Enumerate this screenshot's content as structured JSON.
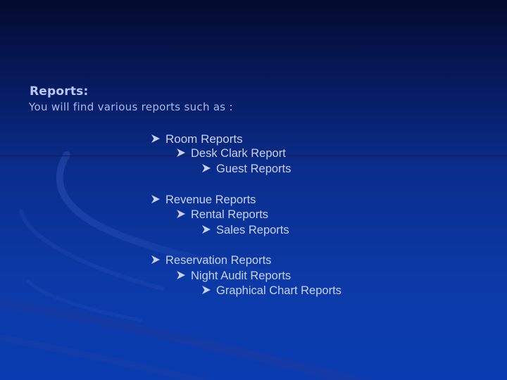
{
  "heading": "Reports:",
  "intro": "You will find various reports such as :",
  "colors": {
    "background": "#0a2d8c",
    "text": "#c6d2ff",
    "heading": "#b9c8ff",
    "bullet": "#c6d2ff"
  },
  "groups": [
    {
      "items": [
        "Room Reports",
        "Desk Clark Report",
        "Guest Reports"
      ]
    },
    {
      "items": [
        "Revenue Reports",
        "Rental Reports",
        "Sales Reports"
      ]
    },
    {
      "items": [
        "Reservation Reports",
        "Night Audit Reports",
        "Graphical Chart Reports"
      ]
    }
  ],
  "bullet_icon": "arrowhead-bullet-icon"
}
